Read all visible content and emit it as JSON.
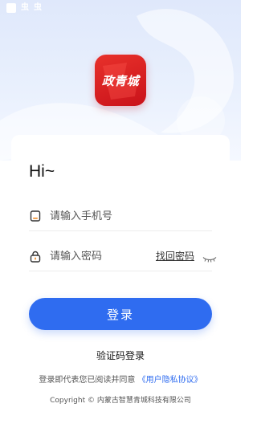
{
  "status_bar": {
    "glyphs": [
      "虫",
      "虫"
    ]
  },
  "logo": {
    "text": "政青城"
  },
  "greeting": "Hi~",
  "phone_field": {
    "placeholder": "请输入手机号",
    "value": ""
  },
  "password_field": {
    "placeholder": "请输入密码",
    "value": "",
    "forgot_label": "找回密码"
  },
  "login_button": {
    "label": "登录"
  },
  "code_login_label": "验证码登录",
  "agreement": {
    "prefix": "登录即代表您已阅读并同意",
    "link": "《用户隐私协议》"
  },
  "copyright": "Copyright © 内蒙古智慧青城科技有限公司",
  "colors": {
    "primary": "#2f6cf0",
    "logo_red": "#d81e22",
    "hero_bg": "#e4ecfc"
  },
  "icons": {
    "phone": "phone-icon",
    "lock": "lock-icon",
    "eye_closed": "eye-closed-icon"
  }
}
